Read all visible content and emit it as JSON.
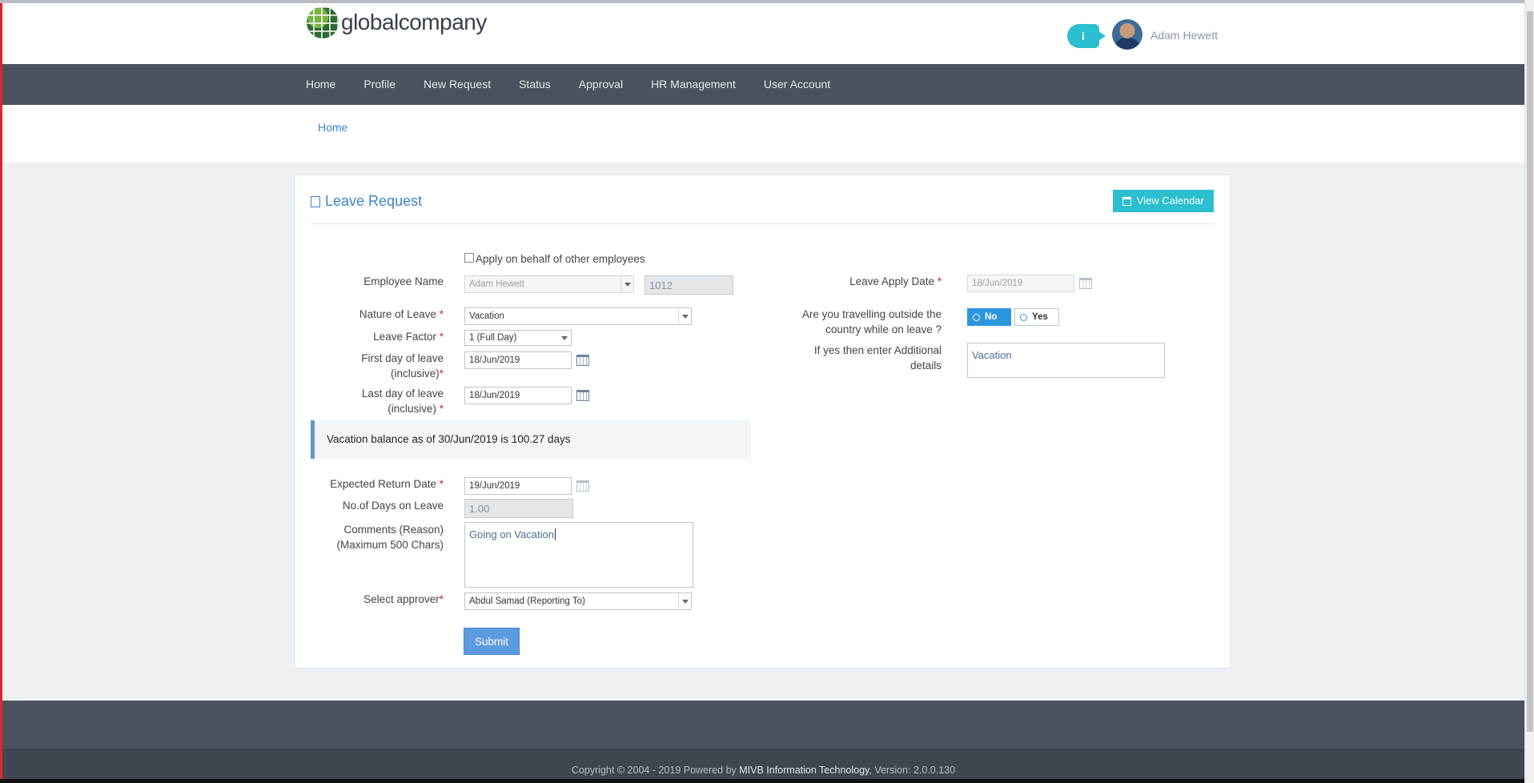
{
  "header": {
    "brand": "globalcompany",
    "info_glyph": "i",
    "user_name": "Adam Hewett"
  },
  "nav": {
    "items": [
      "Home",
      "Profile",
      "New Request",
      "Status",
      "Approval",
      "HR Management",
      "User Account"
    ]
  },
  "breadcrumb": {
    "home": "Home"
  },
  "panel": {
    "title": "Leave Request",
    "view_calendar": "View Calendar"
  },
  "form": {
    "apply_behalf_label": "Apply on behalf of other employees",
    "employee_name_label": "Employee Name",
    "employee_name_value": "Adam Hewett",
    "employee_id": "1012",
    "nature_label": "Nature of Leave",
    "nature_value": "Vacation",
    "factor_label": "Leave Factor",
    "factor_value": "1 (Full Day)",
    "first_day_label_1": "First day of leave",
    "first_day_label_2": "(inclusive)",
    "first_day_value": "18/Jun/2019",
    "last_day_label_1": "Last day of leave",
    "last_day_label_2": "(inclusive)",
    "last_day_value": "18/Jun/2019",
    "balance_text": "Vacation balance as of 30/Jun/2019 is 100.27 days",
    "return_label": "Expected Return Date",
    "return_value": "19/Jun/2019",
    "days_label": "No.of Days on Leave",
    "days_value": "1.00",
    "comments_label_1": "Comments (Reason)",
    "comments_label_2": "(Maximum 500 Chars)",
    "comments_value": "Going on Vacation",
    "approver_label": "Select approver",
    "approver_value": "Abdul Samad (Reporting To)",
    "submit": "Submit",
    "apply_date_label": "Leave Apply Date",
    "apply_date_value": "18/Jun/2019",
    "travel_label_1": "Are you travelling outside the",
    "travel_label_2": "country while on leave ?",
    "travel_no": "No",
    "travel_yes": "Yes",
    "additional_label_1": "If yes then enter Additional",
    "additional_label_2": "details",
    "additional_value": "Vacation",
    "required_mark": "*"
  },
  "footer": {
    "copyright": "Copyright © 2004 - 2019  Powered by ",
    "company": "MIVB Information Technology",
    "version": ", Version: 2.0.0.130"
  },
  "colors": {
    "nav_bg": "#4a535d",
    "accent_teal": "#2bbfcf",
    "link_blue": "#3a84c5",
    "toggle_blue": "#2b96dd",
    "submit_blue": "#5c9be0"
  },
  "icons": [
    "globe-logo-icon",
    "info-icon",
    "document-icon",
    "calendar-icon",
    "chevron-down-icon",
    "radio-icon"
  ]
}
